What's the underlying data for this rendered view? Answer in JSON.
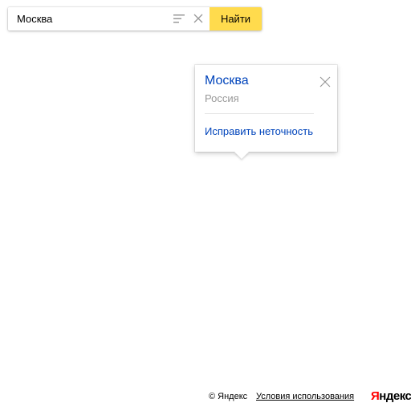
{
  "search": {
    "value": "Москва",
    "button_label": "Найти",
    "list_icon": "list-icon",
    "clear_icon": "close-icon"
  },
  "balloon": {
    "title": "Москва",
    "subtitle": "Россия",
    "link": "Исправить неточность",
    "close_icon": "close-icon"
  },
  "footer": {
    "copyright": "© Яндекс",
    "terms": "Условия использования",
    "logo_first": "Я",
    "logo_rest": "ндекс"
  },
  "colors": {
    "accent_button": "#ffdb4d",
    "link": "#0044bb",
    "subtitle": "#999999",
    "logo_red": "#ff0000"
  }
}
